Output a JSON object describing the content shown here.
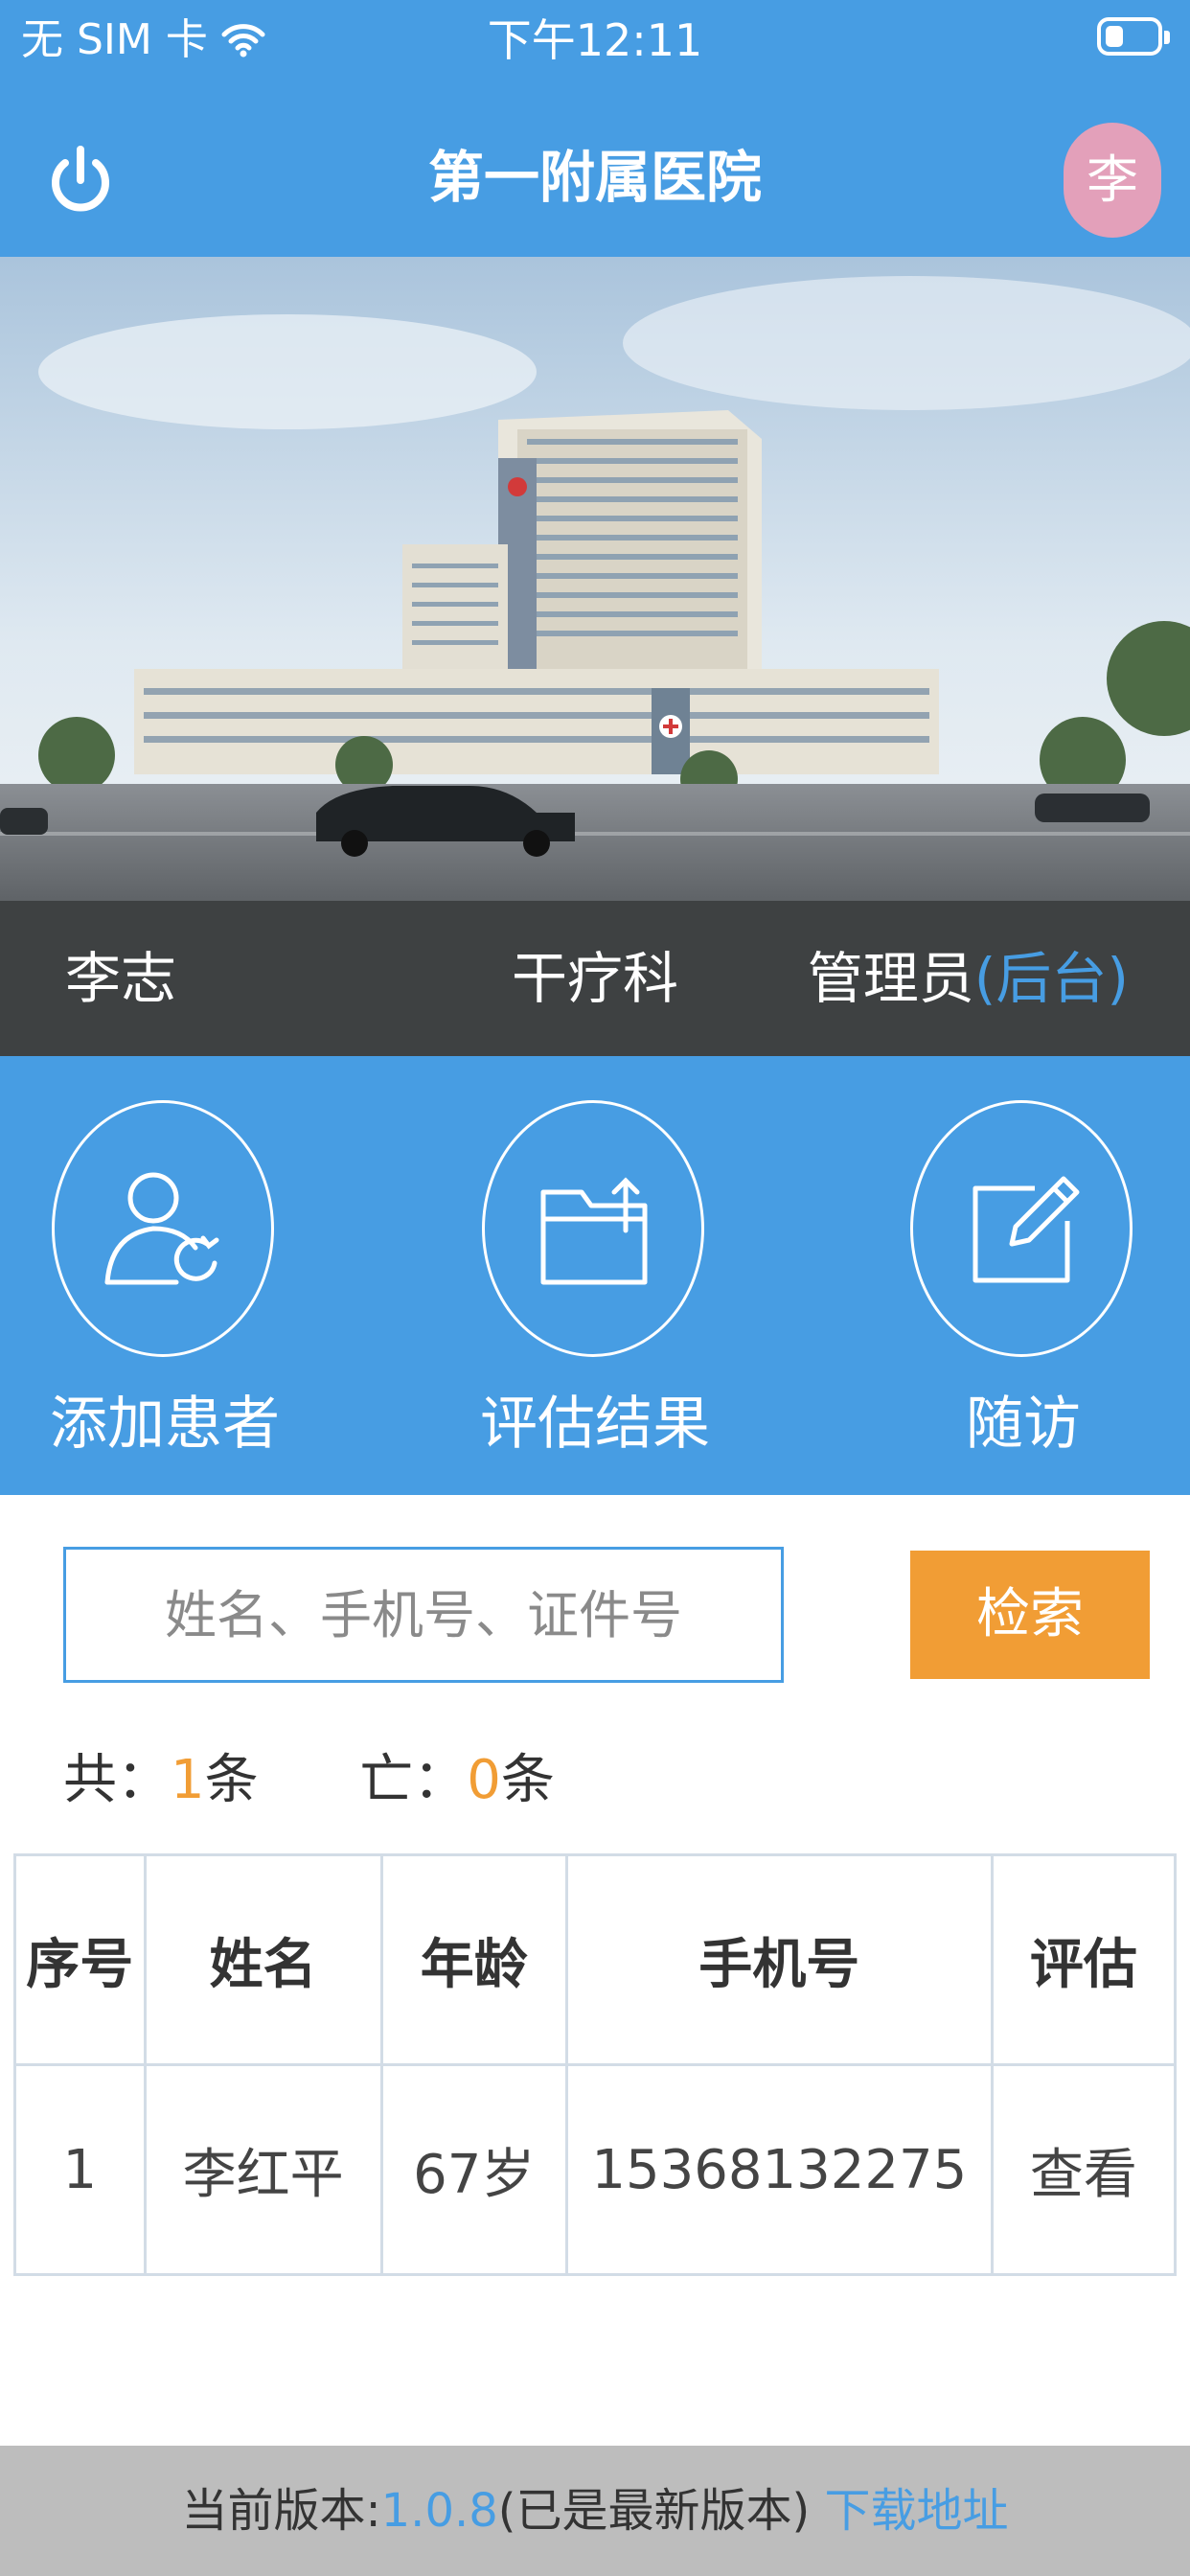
{
  "status_bar": {
    "carrier": "无 SIM 卡",
    "time": "下午12:11"
  },
  "header": {
    "title": "第一附属医院",
    "avatar_text": "李"
  },
  "info_bar": {
    "name": "李志",
    "department": "干疗科",
    "role": "管理员",
    "backend_link": "(后台)"
  },
  "actions": [
    {
      "label": "添加患者",
      "icon": "add-user-icon"
    },
    {
      "label": "评估结果",
      "icon": "folder-upload-icon"
    },
    {
      "label": "随访",
      "icon": "edit-icon"
    }
  ],
  "search": {
    "placeholder": "姓名、手机号、证件号",
    "button_label": "检索"
  },
  "counts": {
    "total_label": "共：",
    "total_value": "1",
    "total_unit": "条",
    "deceased_label": "亡：",
    "deceased_value": "0",
    "deceased_unit": "条"
  },
  "table": {
    "headers": [
      "序号",
      "姓名",
      "年龄",
      "手机号",
      "评估"
    ],
    "rows": [
      {
        "index": "1",
        "name": "李红平",
        "age": "67岁",
        "phone": "15368132275",
        "action": "查看"
      }
    ]
  },
  "footer": {
    "version_label": "当前版本:",
    "version": "1.0.8",
    "version_note": "(已是最新版本)",
    "download_link": "下载地址"
  },
  "colors": {
    "primary": "#479de3",
    "accent": "#f19d35",
    "info_bar_bg": "#3e4142",
    "footer_bg": "#bdbdbd",
    "avatar_bg": "#e3a0ba"
  }
}
